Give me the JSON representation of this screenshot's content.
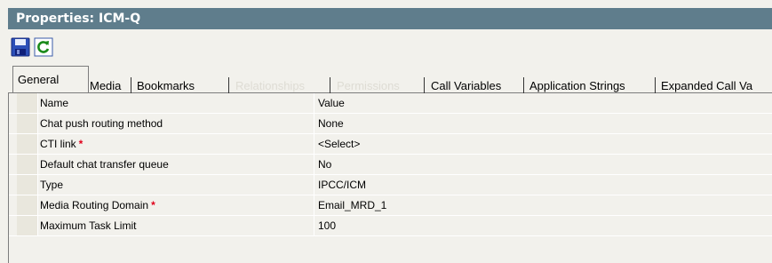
{
  "window": {
    "title": "Properties: ICM-Q"
  },
  "toolbar": {
    "save_icon": "save-icon",
    "refresh_icon": "refresh-icon"
  },
  "tabs": [
    {
      "label": "General",
      "state": "active"
    },
    {
      "label": "Media",
      "state": "normal"
    },
    {
      "label": "Bookmarks",
      "state": "normal"
    },
    {
      "label": "Relationships",
      "state": "disabled"
    },
    {
      "label": "Permissions",
      "state": "disabled"
    },
    {
      "label": "Call Variables",
      "state": "normal"
    },
    {
      "label": "Application Strings",
      "state": "normal"
    },
    {
      "label": "Expanded Call Va",
      "state": "normal"
    }
  ],
  "grid": {
    "header": {
      "name": "Name",
      "value": "Value"
    },
    "rows": [
      {
        "name": "Chat push routing method",
        "value": "None",
        "required": false
      },
      {
        "name": "CTI link",
        "value": "<Select>",
        "required": true
      },
      {
        "name": "Default chat transfer queue",
        "value": "No",
        "required": false
      },
      {
        "name": "Type",
        "value": "IPCC/ICM",
        "required": false
      },
      {
        "name": "Media Routing Domain",
        "value": "Email_MRD_1",
        "required": true
      },
      {
        "name": "Maximum Task Limit",
        "value": "100",
        "required": false
      }
    ],
    "required_marker": "*"
  },
  "colors": {
    "titlebar": "#5f7d8c",
    "required": "#e0001a",
    "disabled_tab": "#dedcd4"
  }
}
